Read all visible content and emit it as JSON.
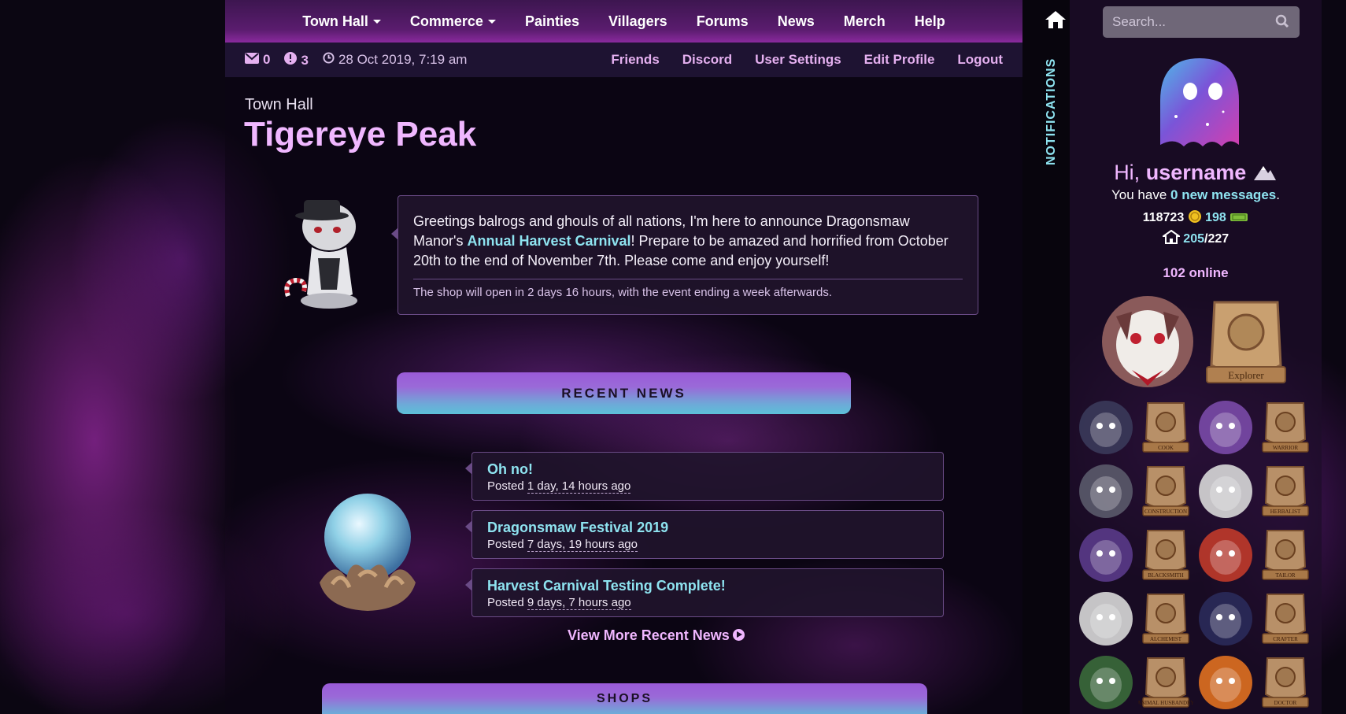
{
  "nav": {
    "items": [
      "Town Hall",
      "Commerce",
      "Painties",
      "Villagers",
      "Forums",
      "News",
      "Merch",
      "Help"
    ]
  },
  "subnav": {
    "mail_count": "0",
    "alert_count": "3",
    "datetime": "28 Oct 2019, 7:19 am",
    "links": [
      "Friends",
      "Discord",
      "User Settings",
      "Edit Profile",
      "Logout"
    ]
  },
  "page": {
    "breadcrumb": "Town Hall",
    "title": "Tigereye Peak"
  },
  "announcement": {
    "text_before": "Greetings balrogs and ghouls of all nations, I'm here to announce Dragonsmaw Manor's ",
    "link": "Annual Harvest Carnival",
    "text_after": "! Prepare to be amazed and horrified from October 20th to the end of November 7th. Please come and enjoy yourself!",
    "note": "The shop will open in 2 days 16 hours, with the event ending a week afterwards."
  },
  "recent_news": {
    "heading": "RECENT NEWS",
    "posted_label": "Posted",
    "items": [
      {
        "title": "Oh no!",
        "ago": "1 day, 14 hours ago"
      },
      {
        "title": "Dragonsmaw Festival 2019",
        "ago": "7 days, 19 hours ago"
      },
      {
        "title": "Harvest Carnival Testing Complete!",
        "ago": "9 days, 7 hours ago"
      }
    ],
    "more": "View More Recent News"
  },
  "shops": {
    "heading": "SHOPS"
  },
  "sidebar": {
    "notifications_label": "NOTIFICATIONS",
    "search_placeholder": "Search...",
    "greeting": "Hi,",
    "username": "username",
    "messages_prefix": "You have",
    "messages_link": "0 new messages",
    "messages_suffix": ".",
    "currency_1": "118723",
    "currency_2": "198",
    "housing_current": "205",
    "housing_total": "/227",
    "online": "102 online",
    "badges": [
      "Explorer",
      "Cook",
      "Warrior",
      "Construction",
      "Herbalist",
      "Blacksmith",
      "Tailor",
      "Alchemist",
      "Crafter",
      "Animal Husbandry",
      "Doctor"
    ]
  },
  "colors": {
    "accent_pink": "#f0b7ff",
    "accent_cyan": "#8ee3f0",
    "nav_purple": "#5a1c6e"
  }
}
